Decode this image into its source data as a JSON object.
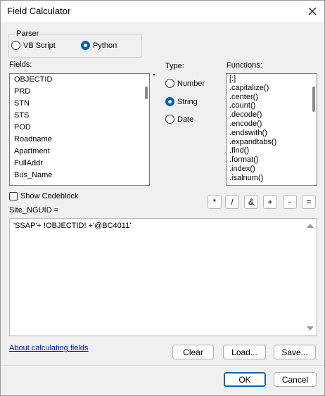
{
  "window": {
    "title": "Field Calculator"
  },
  "parser": {
    "label": "Parser",
    "options": [
      {
        "label": "VB Script",
        "selected": false
      },
      {
        "label": "Python",
        "selected": true
      }
    ]
  },
  "fields": {
    "label": "Fields:",
    "items": [
      "OBJECTID",
      "PRD",
      "STN",
      "STS",
      "POD",
      "Roadname",
      "Apartment",
      "FullAddr",
      "Bus_Name"
    ]
  },
  "type": {
    "label": "Type:",
    "options": [
      {
        "label": "Number",
        "selected": false
      },
      {
        "label": "String",
        "selected": true
      },
      {
        "label": "Date",
        "selected": false
      }
    ]
  },
  "functions": {
    "label": "Functions:",
    "items": [
      "[:]",
      ".capitalize()",
      ".center()",
      ".count()",
      ".decode()",
      ".encode()",
      ".endswith()",
      ".expandtabs()",
      ".find()",
      ".format()",
      ".index()",
      ".isalnum()"
    ]
  },
  "operators": [
    "*",
    "/",
    "&",
    "+",
    "-",
    "="
  ],
  "codeblock": {
    "label": "Show Codeblock",
    "checked": false
  },
  "expression": {
    "target_label": "Site_NGUID =",
    "value": "'SSAP'+ !OBJECTID! +'@BC4011'"
  },
  "footer": {
    "help_link": "About calculating fields",
    "clear": "Clear",
    "load": "Load...",
    "save": "Save...",
    "ok": "OK",
    "cancel": "Cancel"
  },
  "colors": {
    "accent": "#005fb8",
    "link": "#0000ee"
  }
}
